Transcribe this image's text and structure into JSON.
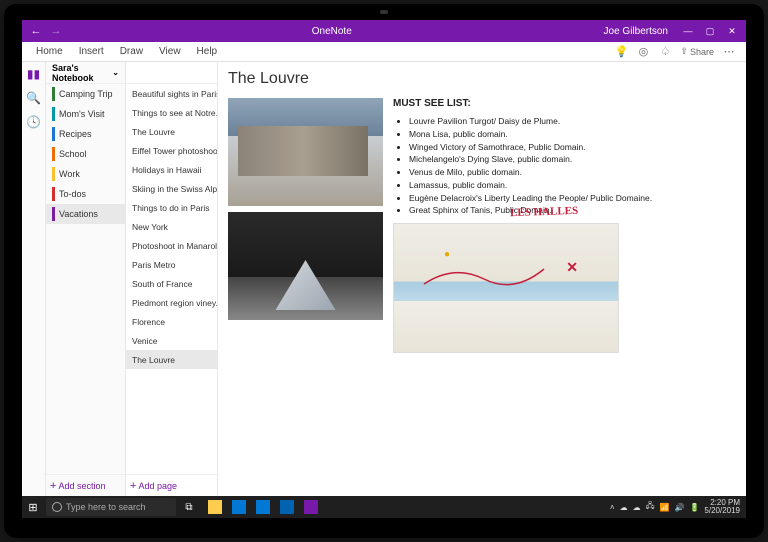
{
  "titlebar": {
    "app": "OneNote",
    "user": "Joe Gilbertson"
  },
  "menu": {
    "items": [
      "Home",
      "Insert",
      "Draw",
      "View",
      "Help"
    ],
    "share": "Share"
  },
  "notebook": {
    "name": "Sara's Notebook",
    "sections": [
      {
        "label": "Camping Trip",
        "color": "#2e7d32"
      },
      {
        "label": "Mom's Visit",
        "color": "#0097a7"
      },
      {
        "label": "Recipes",
        "color": "#1976d2"
      },
      {
        "label": "School",
        "color": "#ef6c00"
      },
      {
        "label": "Work",
        "color": "#fbc02d"
      },
      {
        "label": "To-dos",
        "color": "#d32f2f"
      },
      {
        "label": "Vacations",
        "color": "#7b1fa2",
        "selected": true
      }
    ],
    "add_section": "Add section"
  },
  "pages": {
    "items": [
      "Beautiful sights in Paris",
      "Things to see at Notre...",
      "The Louvre",
      "Eiffel Tower photoshoot",
      "Holidays in Hawaii",
      "Skiing in the Swiss Alps",
      "Things to do in Paris",
      "New York",
      "Photoshoot in Manarola",
      "Paris Metro",
      "South of France",
      "Piedmont region viney...",
      "Florence",
      "Venice",
      "The Louvre"
    ],
    "selected_index": 14,
    "add_page": "Add page"
  },
  "note": {
    "title": "The Louvre",
    "must_see_heading": "MUST SEE LIST:",
    "must_see": [
      "Louvre Pavilion Turgot/ Daisy de Plume.",
      "Mona Lisa, public domain.",
      "Winged Victory of Samothrace, Public Domain.",
      "Michelangelo's Dying Slave, public domain.",
      "Venus de Milo, public domain.",
      "Lamassus, public domain.",
      "Eugène Delacroix's Liberty Leading the People/ Public Domaine.",
      "Great Sphinx of Tanis, Public Domain."
    ],
    "handwriting": "LES HALLES"
  },
  "taskbar": {
    "search_placeholder": "Type here to search",
    "time": "2:20 PM",
    "date": "5/20/2019"
  }
}
